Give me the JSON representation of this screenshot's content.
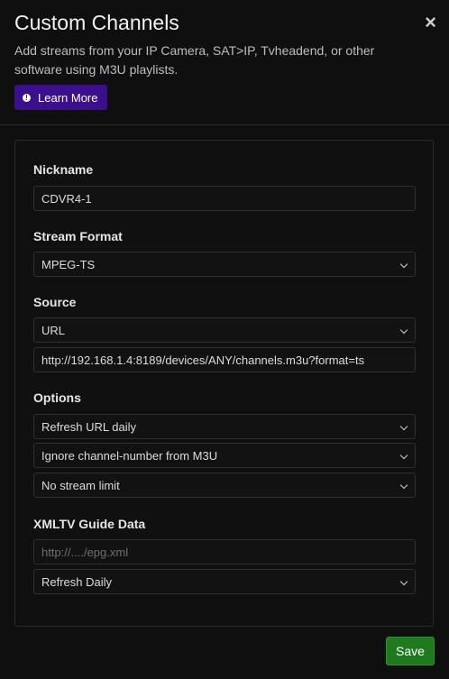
{
  "header": {
    "title": "Custom Channels",
    "close_glyph": "×",
    "subtitle": "Add streams from your IP Camera, SAT>IP, Tvheadend, or other software using M3U playlists.",
    "learn_more_label": "Learn More",
    "learn_more_icon": "info-icon",
    "accent_color": "#3c0f8c"
  },
  "form": {
    "nickname": {
      "label": "Nickname",
      "value": "CDVR4-1"
    },
    "stream_format": {
      "label": "Stream Format",
      "value": "MPEG-TS"
    },
    "source": {
      "label": "Source",
      "type_value": "URL",
      "url_value": "http://192.168.1.4:8189/devices/ANY/channels.m3u?format=ts"
    },
    "options": {
      "label": "Options",
      "refresh": "Refresh URL daily",
      "channel_number": "Ignore channel-number from M3U",
      "stream_limit": "No stream limit"
    },
    "xmltv": {
      "label": "XMLTV Guide Data",
      "url_placeholder": "http://..../epg.xml",
      "refresh": "Refresh Daily"
    }
  },
  "footer": {
    "save_label": "Save",
    "save_color": "#1f7a1f"
  }
}
